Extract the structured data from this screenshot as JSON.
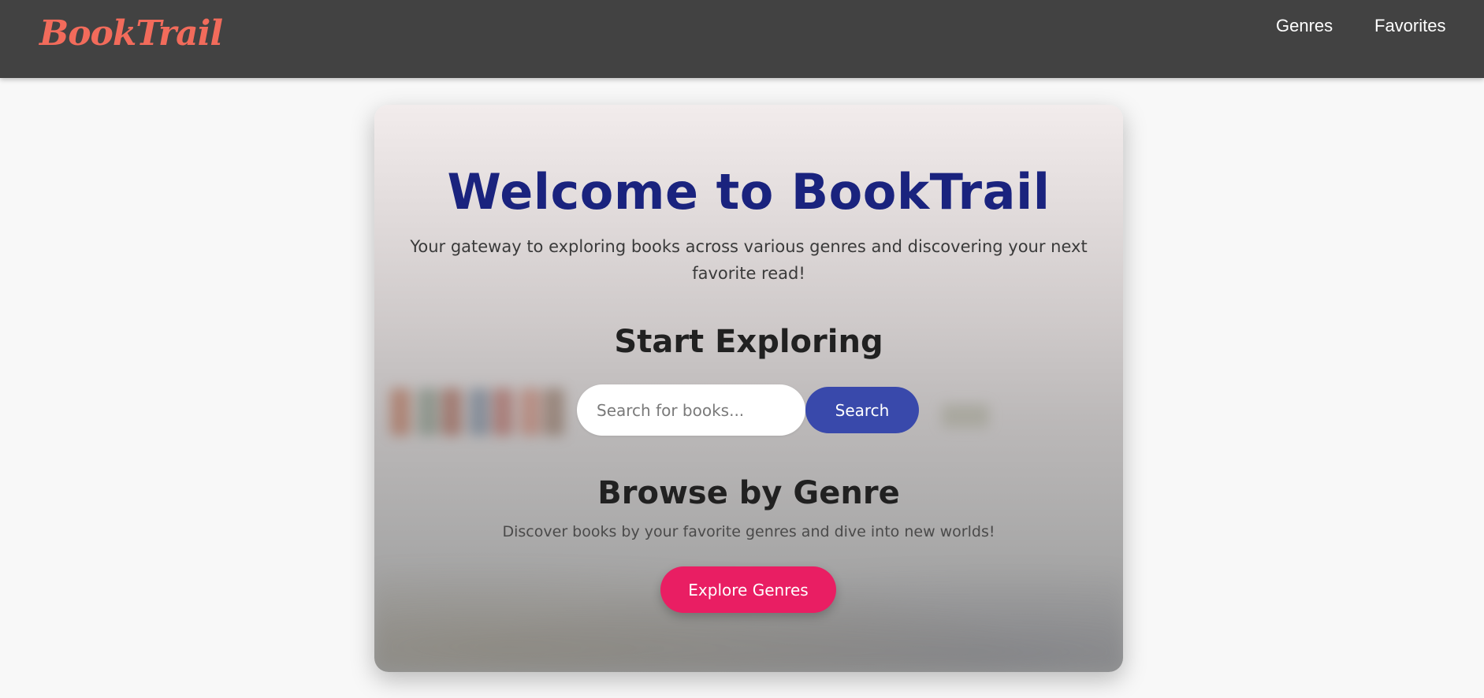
{
  "header": {
    "logo": "BookTrail",
    "nav": [
      {
        "label": "Genres"
      },
      {
        "label": "Favorites"
      }
    ]
  },
  "hero": {
    "title": "Welcome to BookTrail",
    "subtitle": "Your gateway to exploring books across various genres and discovering your next favorite read!"
  },
  "explore": {
    "title": "Start Exploring",
    "search_placeholder": "Search for books...",
    "search_value": "",
    "search_button": "Search"
  },
  "genres": {
    "title": "Browse by Genre",
    "description": "Discover books by your favorite genres and dive into new worlds!",
    "button": "Explore Genres"
  },
  "colors": {
    "header_bg": "#424242",
    "logo": "#f26b5b",
    "hero_title": "#1a237e",
    "search_button": "#3949ab",
    "explore_button": "#e91e63"
  }
}
